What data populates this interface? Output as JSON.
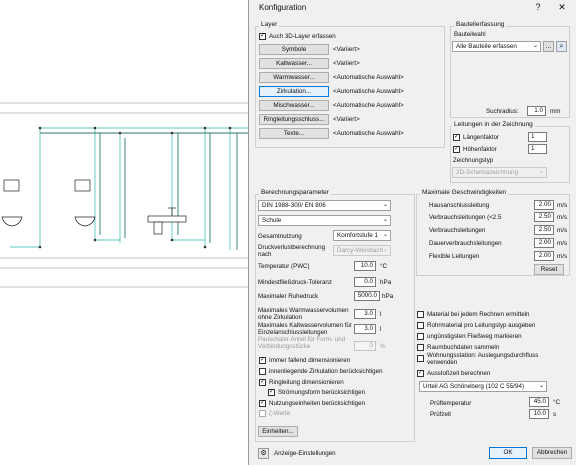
{
  "window": {
    "title": "Konfiguration",
    "help": "?",
    "close": "✕"
  },
  "layer": {
    "group": "Layer",
    "include_3d": "Auch 3D-Layer erfassen",
    "rows": [
      {
        "button": "Symbole",
        "value": "<Variiert>"
      },
      {
        "button": "Kaltwasser...",
        "value": "<Variiert>"
      },
      {
        "button": "Warmwasser...",
        "value": "<Automatische Auswahl>"
      },
      {
        "button": "Zirkulation...",
        "value": "<Automatische Auswahl>"
      },
      {
        "button": "Mischwasser...",
        "value": "<Automatische Auswahl>"
      },
      {
        "button": "Ringleitungsschluss...",
        "value": "<Variiert>"
      },
      {
        "button": "Texte...",
        "value": "<Automatische Auswahl>"
      }
    ]
  },
  "bauteil": {
    "group": "Bauteilerfassung",
    "auswahl_label": "Bauteilwahl",
    "auswahl_value": "Alle Bauteile erfassen",
    "more_btn": "...",
    "suchradius_label": "Suchradius:",
    "suchradius_value": "1.0",
    "suchradius_unit": "mm"
  },
  "leitungen": {
    "group": "Leitungen in der Zeichnung",
    "laenge_label": "Längenfaktor",
    "laenge_value": "1",
    "hoehe_label": "Höhenfaktor",
    "hoehe_value": "1",
    "zeichnungstyp_label": "Zeichnungstyp",
    "zeichnungstyp_value": "2D-Schemazeichnung"
  },
  "berechnung": {
    "group": "Berechnungsparameter",
    "norm": "DIN 1988-300/ EN 806",
    "gebaeude": "Schule",
    "gesamtnutzung_label": "Gesamtnutzung",
    "gesamtnutzung_value": "Komfortstufe 1",
    "druckverlust_label": "Druckverlustberechnung nach",
    "druckverlust_value": "Darcy-Weisbach",
    "temperatur_label": "Temperatur (PWC)",
    "temperatur_value": "10.0",
    "temperatur_unit": "°C",
    "fliessdruck_label": "Mindestfließdruck-Toleranz",
    "fliessdruck_value": "0.0",
    "fliessdruck_unit": "hPa",
    "ruhedruck_label": "Maximaler Ruhedruck",
    "ruhedruck_value": "5000.0",
    "ruhedruck_unit": "hPa",
    "warm_label": "Maximales Warmwasservolumen ohne Zirkulation",
    "warm_value": "3.0",
    "warm_unit": "l",
    "kalt_label": "Maximales Kaltwasservolumen für Einzelanschlussleitungen",
    "kalt_value": "3.0",
    "kalt_unit": "l",
    "pauschal_label": "Pauschaler Anteil für Form- und Verbindungsstücke",
    "pauschal_value": "0",
    "pauschal_unit": "%",
    "checks": [
      {
        "label": "Immer fallend dimensionieren",
        "checked": true
      },
      {
        "label": "innenliegende Zirkulation berücksichtigen",
        "checked": false
      },
      {
        "label": "Ringleitung dimensionieren",
        "checked": true
      },
      {
        "label": "Strömungsform berücksichtigen",
        "checked": true
      },
      {
        "label": "Nutzungseinheiten berücksichtigen",
        "checked": true
      },
      {
        "label": "ζ-Werte",
        "checked": false
      }
    ],
    "einheiten_btn": "Einheiten..."
  },
  "geschw": {
    "group": "Maximale Geschwindigkeiten",
    "rows": [
      {
        "label": "Hausanschlussleitung",
        "value": "2.00",
        "unit": "m/s"
      },
      {
        "label": "Verbrauchsleitungen (<2.5",
        "value": "2.50",
        "unit": "m/s"
      },
      {
        "label": "Verbrauchsleitungen",
        "value": "2.50",
        "unit": "m/s"
      },
      {
        "label": "Dauerverbrauchsleitungen",
        "value": "2.00",
        "unit": "m/s"
      },
      {
        "label": "Flexible Leitungen",
        "value": "2.00",
        "unit": "m/s"
      }
    ],
    "reset_btn": "Reset"
  },
  "optionen": {
    "checks": [
      {
        "label": "Material bei jedem Rechnen ermitteln",
        "checked": false
      },
      {
        "label": "Rohrmaterial pro Leitungstyp ausgeben",
        "checked": false
      },
      {
        "label": "ungünstigsten Fließweg markieren",
        "checked": false
      },
      {
        "label": "Raumbuchdaten sammeln",
        "checked": false
      },
      {
        "label": "Wohnungsstation: Auslegungsdurchfluss verwenden",
        "checked": false
      },
      {
        "label": "Ausstoßzeit berechnen",
        "checked": true
      }
    ],
    "ausstoss_select": "Urteil AG Schöneberg (102 C 55/94)",
    "pruef_temp_label": "Prüftemperatur",
    "pruef_temp_value": "45.0",
    "pruef_temp_unit": "°C",
    "pruef_zeit_label": "Prüfzeit",
    "pruef_zeit_value": "10.0",
    "pruef_zeit_unit": "s"
  },
  "footer": {
    "anzeige": "Anzeige-Einstellungen",
    "ok": "OK",
    "cancel": "Abbrechen"
  },
  "colors": {
    "accent": "#0078d7",
    "pipe": "#5ec9c0",
    "pipe_dark": "#2f7a6f"
  }
}
